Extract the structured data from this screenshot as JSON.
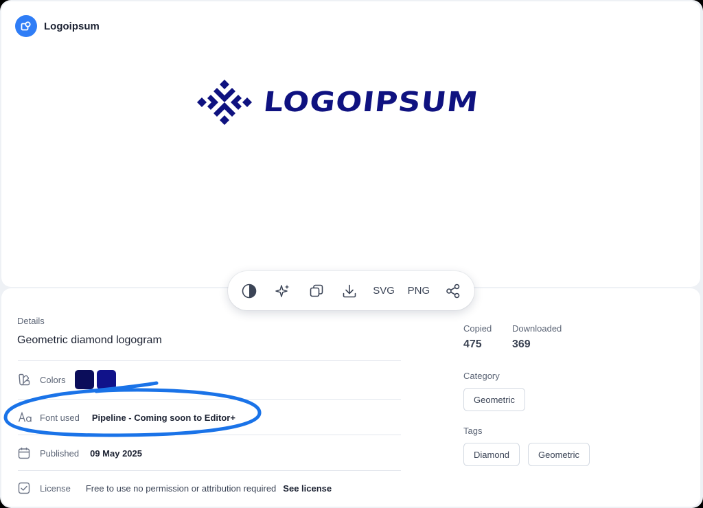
{
  "brand": {
    "name": "Logoipsum",
    "icon": "logo-badge-icon",
    "accent": "#2f7df6"
  },
  "logo": {
    "wordmark": "LOGOIPSUM",
    "color": "#0f1280"
  },
  "toolbar": {
    "contrast_icon": "contrast-icon",
    "ai_icon": "sparkle-icon",
    "copy_icon": "copy-icon",
    "download_icon": "download-icon",
    "svg_label": "SVG",
    "png_label": "PNG",
    "share_icon": "share-icon"
  },
  "details": {
    "heading": "Details",
    "title": "Geometric diamond logogram",
    "colors_label": "Colors",
    "colors": [
      "#0b0d5a",
      "#10128a"
    ],
    "font_label": "Font used",
    "font_value": "Pipeline - Coming soon to Editor+",
    "published_label": "Published",
    "published_value": "09 May 2025",
    "license_label": "License",
    "license_value": "Free to use no permission or attribution required",
    "license_link": "See license"
  },
  "stats": {
    "copied_label": "Copied",
    "copied_value": "475",
    "downloaded_label": "Downloaded",
    "downloaded_value": "369"
  },
  "category": {
    "label": "Category",
    "items": [
      "Geometric"
    ]
  },
  "tags": {
    "label": "Tags",
    "items": [
      "Diamond",
      "Geometric"
    ]
  },
  "annotation_color": "#1a73e8"
}
